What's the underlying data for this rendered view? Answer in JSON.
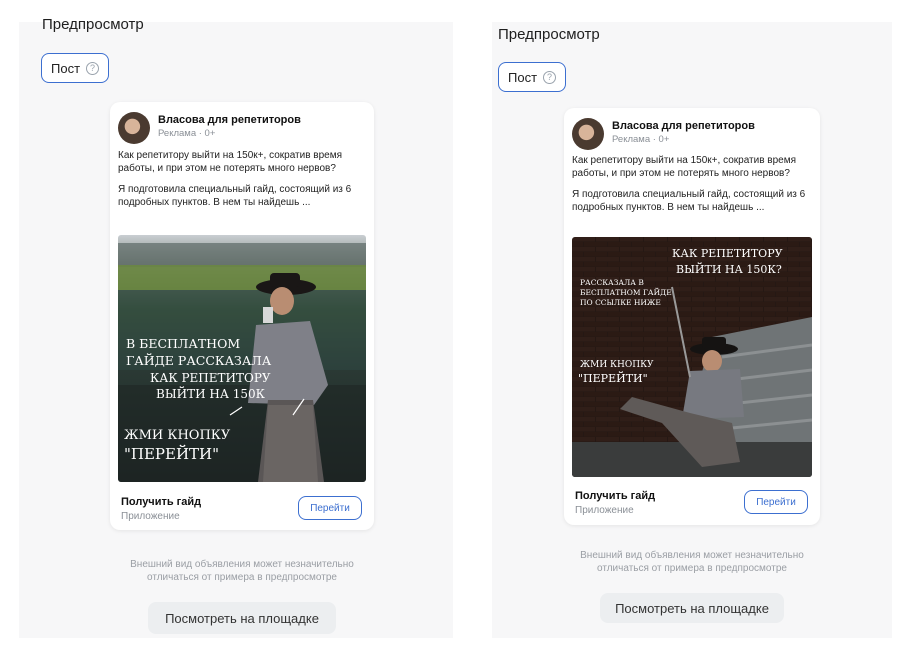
{
  "title": "Предпросмотр",
  "format_button": {
    "label": "Пост",
    "help_icon": "question-circle-icon"
  },
  "ad": {
    "author": "Власова для репетиторов",
    "meta": "Реклама · 0+",
    "text_p1": "Как репетитору выйти на 150к+, сократив время работы, и при этом не потерять много нервов?",
    "text_p2": "Я подготовила специальный гайд, состоящий из 6 подробных пунктов. В нем ты найдешь ...",
    "cta_title": "Получить гайд",
    "cta_sub": "Приложение",
    "cta_button": "Перейти"
  },
  "left_image": {
    "line1": "В БЕСПЛАТНОМ",
    "line2": "ГАЙДЕ РАССКАЗАЛА",
    "line3": "КАК РЕПЕТИТОРУ",
    "line4": "ВЫЙТИ НА 150К",
    "line5": "ЖМИ КНОПКУ",
    "line6": "\"ПЕРЕЙТИ\""
  },
  "right_image": {
    "line1": "КАК РЕПЕТИТОРУ",
    "line2": "ВЫЙТИ НА 150К?",
    "line3": "РАССКАЗАЛА В",
    "line4": "БЕСПЛАТНОМ ГАЙДЕ",
    "line5": "ПО ССЫЛКЕ НИЖЕ",
    "line6": "ЖМИ КНОПКУ",
    "line7": "\"ПЕРЕЙТИ\""
  },
  "disclaimer_line1": "Внешний вид объявления может незначительно",
  "disclaimer_line2": "отличаться от примера в предпросмотре",
  "view_button": "Посмотреть на площадке",
  "colors": {
    "accent": "#3c6fd0",
    "panel_bg": "#f7f7f8"
  }
}
